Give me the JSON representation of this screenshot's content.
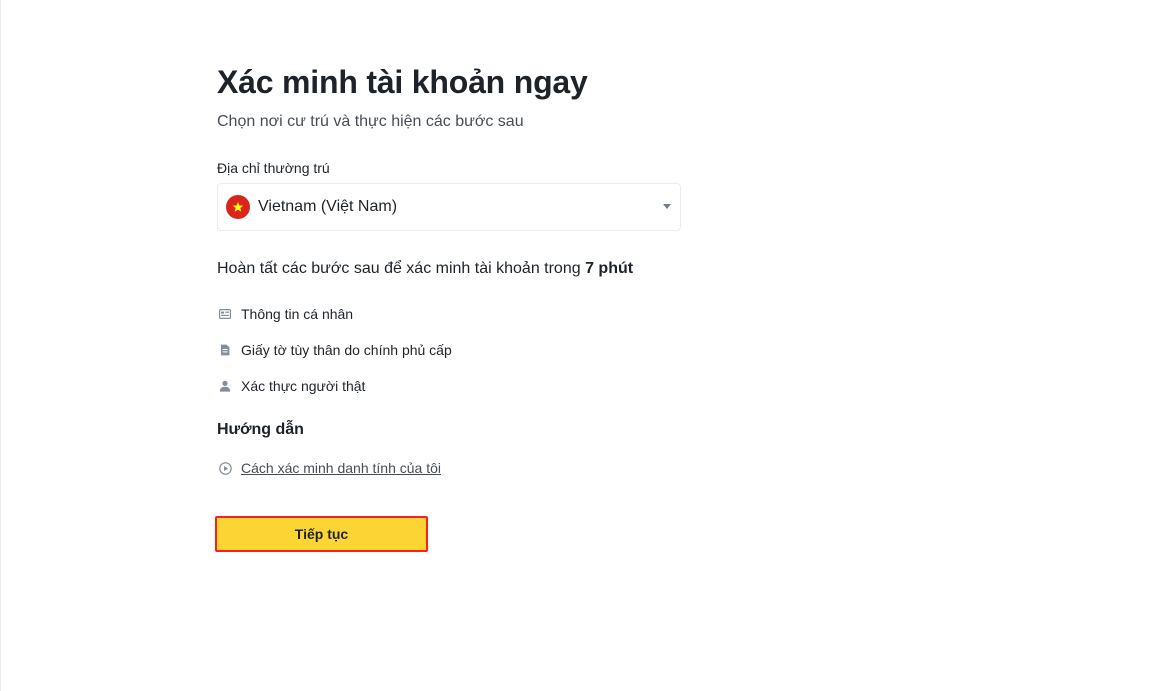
{
  "page": {
    "title": "Xác minh tài khoản ngay",
    "subtitle": "Chọn nơi cư trú và thực hiện các bước sau"
  },
  "residence": {
    "label": "Địa chỉ thường trú",
    "selected_country": "Vietnam (Việt Nam)",
    "flag_icon": "vietnam-flag-icon"
  },
  "time_estimate": {
    "prefix": "Hoàn tất các bước sau để xác minh tài khoản trong",
    "duration": "7 phút"
  },
  "steps": [
    {
      "icon": "id-card-icon",
      "label": "Thông tin cá nhân"
    },
    {
      "icon": "document-icon",
      "label": "Giấy tờ tùy thân do chính phủ cấp"
    },
    {
      "icon": "person-icon",
      "label": "Xác thực người thật"
    }
  ],
  "guide": {
    "heading": "Hướng dẫn",
    "link_icon": "play-circle-icon",
    "link_label": "Cách xác minh danh tính của tôi"
  },
  "actions": {
    "continue_label": "Tiếp tục"
  },
  "colors": {
    "primary_button": "#fcd535",
    "highlight_border": "#f5221d",
    "flag_red": "#da251d",
    "flag_star": "#ffff00"
  }
}
